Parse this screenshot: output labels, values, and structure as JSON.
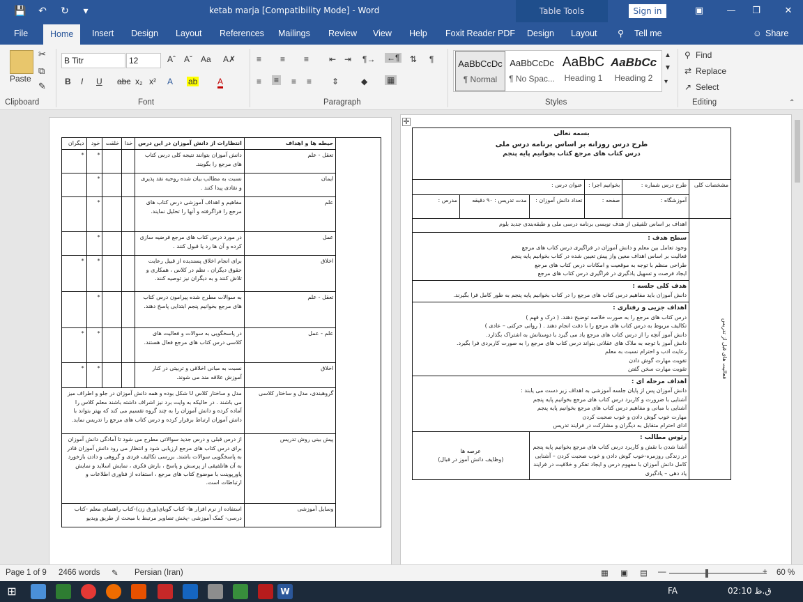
{
  "window": {
    "title": "ketab marja [Compatibility Mode]  -  Word",
    "table_tools": "Table Tools",
    "sign_in": "Sign in"
  },
  "tabs": [
    "File",
    "Home",
    "Insert",
    "Design",
    "Layout",
    "References",
    "Mailings",
    "Review",
    "View",
    "Help",
    "Foxit Reader PDF",
    "Design",
    "Layout",
    "Tell me",
    "Share"
  ],
  "ribbon": {
    "clipboard": {
      "paste": "Paste",
      "label": "Clipboard"
    },
    "font": {
      "name": "B Titr",
      "size": "12",
      "label": "Font"
    },
    "paragraph": {
      "label": "Paragraph"
    },
    "styles": {
      "label": "Styles",
      "items": [
        {
          "preview": "AaBbCcDc",
          "name": "¶ Normal"
        },
        {
          "preview": "AaBbCcDc",
          "name": "¶ No Spac..."
        },
        {
          "preview": "AaBbC",
          "name": "Heading 1"
        },
        {
          "preview": "AaBbCc",
          "name": "Heading 2"
        }
      ]
    },
    "editing": {
      "find": "Find",
      "replace": "Replace",
      "select": "Select",
      "label": "Editing"
    }
  },
  "left_page": {
    "headers": [
      "حیطه ها و اهداف",
      "انتظارات از دانش آموزان در این درس",
      "خدا",
      "خلقت",
      "خود",
      "دیگران"
    ],
    "rows": [
      {
        "domain": "تعقل - علم",
        "text": "دانش آموزان بتوانند نتیجه کلی درس کتاب های مرجع را بگویند.",
        "marks": [
          "",
          "",
          "*",
          "*"
        ]
      },
      {
        "domain": "ایمان",
        "text": "نسبت به مطالب بیان شده روحیه نقد پذیری و نقادی پیدا کنند .",
        "marks": [
          "",
          "",
          "*",
          ""
        ]
      },
      {
        "domain": "علم",
        "text": "مفاهیم و اهداف آموزشی درس کتاب های مرجع را فراگرفته و آنها را تحلیل نمایند.",
        "marks": [
          "",
          "",
          "*",
          ""
        ]
      },
      {
        "domain": "عمل",
        "text": "در مورد درس کتاب های مرجع فرضیه سازی کرده و آن ها رد یا قبول کنند .",
        "marks": [
          "",
          "",
          "*",
          ""
        ]
      },
      {
        "domain": "اخلاق",
        "text": "برای انجام اخلاق پسندیده از قبیل رعایت حقوق دیگران ، نظم در کلاس ، همکاری و تلاش کنند و به دیگران نیز توصیه کنند.",
        "marks": [
          "",
          "",
          "*",
          "*"
        ]
      },
      {
        "domain": "تعقل - علم",
        "text": "به سوالات مطرح شده پیرامون درس کتاب های مرجع بخوانیم پنجم ابتدایی پاسخ دهند.",
        "marks": [
          "",
          "",
          "*",
          ""
        ]
      },
      {
        "domain": "علم - عمل",
        "text": "در پاسخگویی به سوالات و فعالیت های کلاسی درس کتاب های مرجع فعال هستند.",
        "marks": [
          "",
          "",
          "*",
          "*"
        ]
      },
      {
        "domain": "اخلاق",
        "text": "نسبت به مبانی اخلاقی و تربیتی در کنار آموزش علاقه مند می شوند.",
        "marks": [
          "",
          "",
          "*",
          "*"
        ]
      }
    ],
    "grouping": {
      "label": "گروهبندی، مدل و ساختار کلاسی",
      "text": "مدل و ساختار کلاس U شکل بوده و همه دانش آموزان در جلو و اطراف میز می باشند . در حالیکه به وایت برد نیز اشراف داشته باشند معلم کلاس را آماده کرده و دانش آموزان را به چند گروه تقسیم می کند که بهتر بتواند با دانش آموزان ارتباط برقرار کرده و درس کتاب های مرجع را تدریس نماید."
    },
    "preview": {
      "label": "پیش بینی روش تدریس",
      "text": "از درس قبلی و درس جدید سوالاتی مطرح می شود تا آمادگی دانش آموزان برای درس کتاب های مرجع ارزیابی شود و انتظار می رود دانش آموزان قادر به پاسخگویی سوالات باشند. بررسی تکالیف فردی و گروهی و دادن بازخورد به آن هاتلفیقی از پرسش و پاسخ ، بارش فکری ، نمایش اسلاید و نمایش پاورپوینت با موضوع کتاب های مرجع ، استفاده از فناوری اطلاعات و ارتباطات است."
    },
    "tools": {
      "label": "وسایل آموزشی",
      "text": "استفاده از نرم افزار ها- کتاب گویای(ورق زن)-کتاب راهنمای معلم -کتاب درسی- کمک آموزشی -پخش تصاویر مرتبط با مبحث از طریق ویدیو"
    }
  },
  "right_page": {
    "basmala": "بسمه تعالی",
    "title1": "طرح درس روزانه بر اساس برنامه درس ملی",
    "title2": "درس کتاب های مرجع کتاب بخوانیم پایه پنجم",
    "general_label": "مشخصات کلی",
    "info": {
      "plan_no": "طرح درس شماره :",
      "read_class": "بخوانیم اجرا :",
      "lesson_title": "عنوان درس :",
      "school": "آموزشگاه :",
      "page": "صفحه :",
      "students": "تعداد دانش آموزان :",
      "duration": "مدت تدریس : ۹۰ دقیقه",
      "teacher": "مدرس :"
    },
    "side_label": "فعالیت های قبل از تدریس",
    "goals_intro": "اهداف بر اساس تلفیقی از هدف نویسی برنامه درسی ملی و طبقه‌بندی جدید بلوم",
    "level_goal": {
      "title": "سطح هدف :",
      "lines": [
        "وجود تعامل بین معلم و دانش آموزان در فراگیری درس کتاب های مرجع",
        "فعالیت بر اساس اهداف معین واز پیش تعیین شده در کتاب بخوانیم پایه پنجم",
        "طراحی منظم با توجه به موقعیت و امکانات درس کتاب های مرجع",
        "ایجاد فرصت و تسهیل یادگیری در فراگیری درس کتاب های مرجع"
      ]
    },
    "session_goal": {
      "title": "هدف کلی جلسه :",
      "lines": [
        "دانش آموزان باید مفاهیم درس کتاب های مرجع را در کتاب بخوانیم پایه پنجم به طور کامل فرا بگیرند."
      ]
    },
    "partial_goals": {
      "title": "اهداف جزیی و رفتاری :",
      "lines": [
        "درس کتاب های مرجع را به صورت خلاصه توضیح دهند. ( درک و فهم )",
        "تکالیف مربوط به درس کتاب های مرجع را با دقت انجام دهند . ( روانی حرکتی – عادی )",
        "دانش آموز آنچه را از درس کتاب های مرجع یاد می گیرد با دوستانش به اشتراک بگذارد.",
        "دانش آموز با توجه به ملاک های عقلانی بتواند درس کتاب های مرجع را به صورت کاربردی فرا بگیرد.",
        "رعایت ادب و احترام نسبت به معلم",
        "تقویت مهارت گوش دادن",
        "تقویت مهارت سخن گفتن"
      ]
    },
    "step_goals": {
      "title": "اهداف مرحله ای :",
      "lines": [
        "دانش آموزان پس از پایان جلسه آموزشی به اهداف زیر دست می یابند :",
        "آشنایی با ضرورت و کاربرد درس کتاب های مرجع بخوانیم پایه پنجم",
        "آشنایی با مبانی و مفاهیم درس کتاب های مرجع بخوانیم پایه پنجم",
        "مهارت خوب گوش دادن و خوب صحبت کردن",
        "ادای احترام متقابل به دیگران و مشارکت در فرایند تدریس"
      ]
    },
    "headings": {
      "title": "رئوس مطالب :",
      "col_label1": "عرصه ها",
      "col_label2": "(وظایف دانش آموز در قبال)",
      "text": "آشنا شدن با نقش و کاربرد درس کتاب های مرجع بخوانیم پایه پنجم در زندگی روزمره-خوب گوش دادن و خوب صحبت کردن – آشنایی کامل دانش آموزان با مفهوم درس و ایجاد تفکر و خلاقیت در فرایند یاد دهی – یادگیری"
    }
  },
  "statusbar": {
    "page": "Page 1 of 9",
    "words": "2466 words",
    "language": "Persian (Iran)",
    "zoom": "60 %"
  },
  "taskbar": {
    "lang": "FA",
    "time": "02:10 ق.ظ"
  }
}
